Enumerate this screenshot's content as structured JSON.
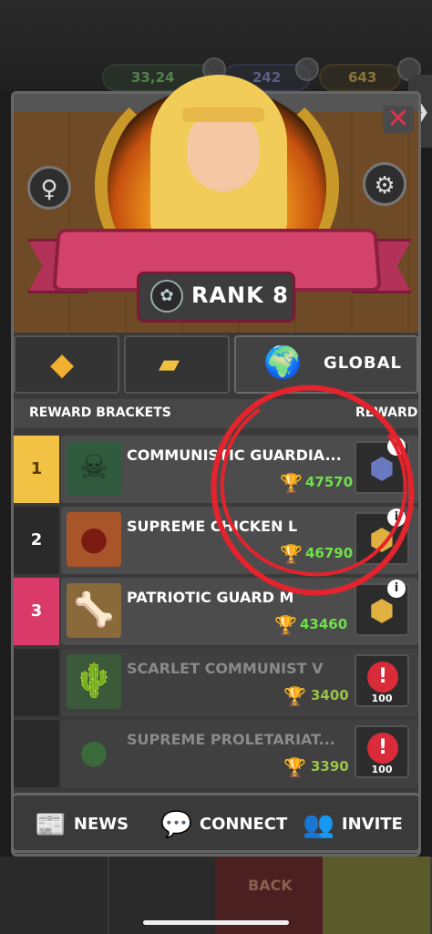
{
  "top_resources": {
    "green_value": "33,24",
    "purple_value": "242",
    "gold_value": "643"
  },
  "header": {
    "rank_label": "RANK 8",
    "left_button_icon": "female-symbol-icon",
    "right_button_icon": "gear-icon",
    "close_icon": "close-icon"
  },
  "tabs": [
    {
      "icon": "diamond-gem-icon",
      "label": ""
    },
    {
      "icon": "gold-bars-icon",
      "label": ""
    },
    {
      "icon": "globe-laurel-icon",
      "label": "GLOBAL"
    }
  ],
  "list_header": {
    "left": "REWARD BRACKETS",
    "right": "REWARD"
  },
  "rows": [
    {
      "rank": "1",
      "name": "COMMUNISTIC GUARDIA...",
      "score": "47570",
      "icon": "skull-icon",
      "reward": "belt-icon"
    },
    {
      "rank": "2",
      "name": "SUPREME CHICKEN L",
      "score": "46790",
      "icon": "bomb-icon",
      "reward": "belt-icon"
    },
    {
      "rank": "3",
      "name": "PATRIOTIC GUARD M",
      "score": "43460",
      "icon": "dino-skull-icon",
      "reward": "belt-icon"
    },
    {
      "rank": "",
      "name": "SCARLET COMMUNIST V",
      "score": "3400",
      "icon": "cactus-icon",
      "reward_count": "100"
    },
    {
      "rank": "",
      "name": "SUPREME PROLETARIAT...",
      "score": "3390",
      "icon": "bomb-icon",
      "reward_count": "100"
    }
  ],
  "bottom_bar": {
    "news": "NEWS",
    "connect": "CONNECT",
    "invite": "INVITE"
  },
  "underlay": {
    "back": "BACK"
  },
  "colors": {
    "gold_rank": "#f2c244",
    "pink_rank": "#d93a6a",
    "score_green": "#6ee04a",
    "annotation_red": "#e4232d"
  }
}
